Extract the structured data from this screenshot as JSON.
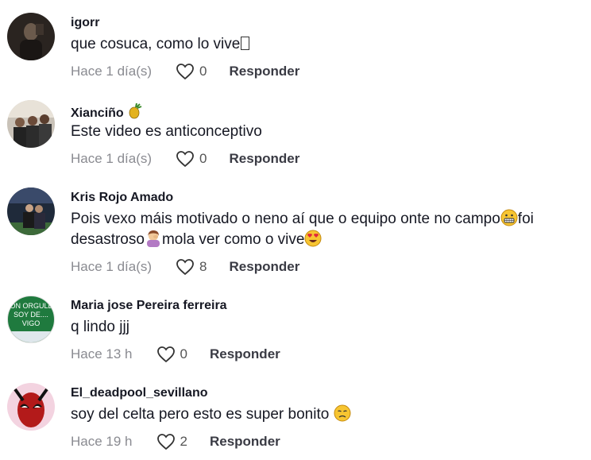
{
  "comments": [
    {
      "username": "igorr",
      "text": "que cosuca, como lo vive",
      "time": "Hace 1 día(s)",
      "likes": "0",
      "reply": "Responder"
    },
    {
      "username": "Xianciño",
      "text": "Este video es anticonceptivo",
      "time": "Hace 1 día(s)",
      "likes": "0",
      "reply": "Responder"
    },
    {
      "username": "Kris Rojo Amado",
      "text_line1": "Pois vexo máis motivado o neno aí que o equipo onte no campo",
      "text_line1_end": "foi",
      "text_line2_a": "desastroso",
      "text_line2_b": "mola ver como o vive",
      "time": "Hace 1 día(s)",
      "likes": "8",
      "reply": "Responder"
    },
    {
      "username": "Maria jose Pereira ferreira",
      "text": "q lindo jjj",
      "time": "Hace 13 h",
      "likes": "0",
      "reply": "Responder",
      "avatar_text": [
        "ON ORGULL",
        "SOY DE....",
        "VIGO"
      ]
    },
    {
      "username": "El_deadpool_sevillano",
      "text": "soy del celta pero esto es super bonito",
      "time": "Hace 19 h",
      "likes": "2",
      "reply": "Responder"
    }
  ],
  "icons": {
    "like": "heart-outline-icon",
    "badge": "pineapple-icon",
    "emoji_grimace": "grimacing-face-icon",
    "emoji_facepalm": "facepalm-icon",
    "emoji_hearteyes": "heart-eyes-icon",
    "emoji_disappointed": "disappointed-face-icon"
  },
  "colors": {
    "text": "#161823",
    "muted": "#8a8b91",
    "reply": "#3a3b44"
  }
}
